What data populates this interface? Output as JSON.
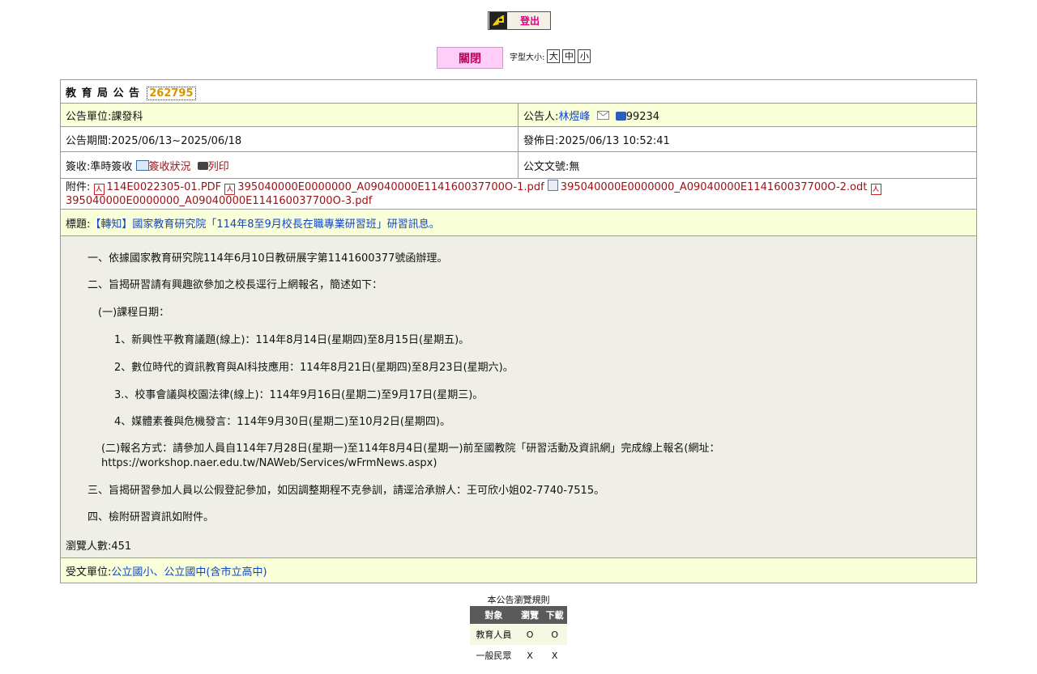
{
  "top": {
    "logout_label": "登出",
    "close_label": "關閉",
    "font_size_label": "字型大小:",
    "font_sizes": [
      "大",
      "中",
      "小"
    ]
  },
  "announcement": {
    "header_label": "教 育 局 公 告",
    "id": "262795",
    "unit": "公告單位:課發科",
    "announcer_prefix": "公告人:",
    "announcer_name": "林煜峰",
    "phone": "99234",
    "period": "公告期間:2025/06/13~2025/06/18",
    "publish_date": "發佈日:2025/06/13 10:52:41",
    "signoff_prefix": "簽收:準時簽收",
    "signoff_status_link": "簽收狀況",
    "print_link": "列印",
    "doc_number": "公文文號:無",
    "attachments_label": "附件:",
    "attachments": [
      {
        "name": "114E0022305-01.PDF",
        "type": "pdf"
      },
      {
        "name": "395040000E0000000_A09040000E114160037700O-1.pdf",
        "type": "pdf"
      },
      {
        "name": "395040000E0000000_A09040000E114160037700O-2.odt",
        "type": "odt"
      },
      {
        "name": "395040000E0000000_A09040000E114160037700O-3.pdf",
        "type": "pdf"
      }
    ],
    "title_label": "標題:",
    "title": "【轉知】國家教育研究院「114年8至9月校長在職專業研習班」研習訊息。",
    "body": [
      "一、依據國家教育研究院114年6月10日教研展字第1141600377號函辦理。",
      "二、旨揭研習請有興趣欲參加之校長逕行上網報名，簡述如下：",
      "(一)課程日期：",
      "1、新興性平教育議題(線上)：114年8月14日(星期四)至8月15日(星期五)。",
      "2、數位時代的資訊教育與AI科技應用：114年8月21日(星期四)至8月23日(星期六)。",
      "3.、校事會議與校園法律(線上)：114年9月16日(星期二)至9月17日(星期三)。",
      "4、媒體素養與危機發言：114年9月30日(星期二)至10月2日(星期四)。",
      "(二)報名方式：請參加人員自114年7月28日(星期一)至114年8月4日(星期一)前至國教院「研習活動及資訊網」完成線上報名(網址：",
      "https://workshop.naer.edu.tw/NAWeb/Services/wFrmNews.aspx)",
      "三、旨揭研習參加人員以公假登記參加，如因調整期程不克參訓，請逕洽承辦人：王可欣小姐02-7740-7515。",
      "四、檢附研習資訊如附件。"
    ],
    "views": "瀏覽人數:451",
    "recipients_label": "受文單位:",
    "recipients": "公立國小、公立國中(含市立高中)"
  },
  "rules": {
    "title": "本公告瀏覽規則",
    "headers": [
      "對象",
      "瀏覽",
      "下載"
    ],
    "rows": [
      [
        "教育人員",
        "O",
        "O"
      ],
      [
        "一般民眾",
        "X",
        "X"
      ]
    ]
  }
}
